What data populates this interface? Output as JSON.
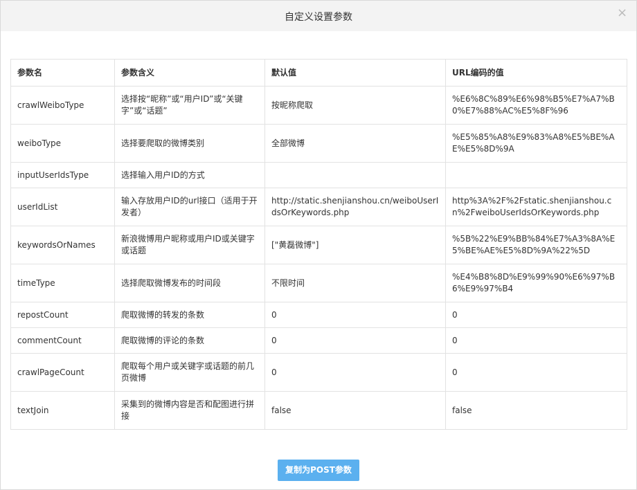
{
  "dialog": {
    "title": "自定义设置参数",
    "close_icon": "×"
  },
  "table": {
    "headers": [
      "参数名",
      "参数含义",
      "默认值",
      "URL编码的值"
    ],
    "rows": [
      {
        "name": "crawlWeiboType",
        "meaning": "选择按“昵称”或“用户ID”或“关键字”或“话题”",
        "default": "按昵称爬取",
        "encoded": "%E6%8C%89%E6%98%B5%E7%A7%B0%E7%88%AC%E5%8F%96"
      },
      {
        "name": "weiboType",
        "meaning": "选择要爬取的微博类别",
        "default": "全部微博",
        "encoded": "%E5%85%A8%E9%83%A8%E5%BE%AE%E5%8D%9A"
      },
      {
        "name": "inputUserIdsType",
        "meaning": "选择输入用户ID的方式",
        "default": "",
        "encoded": ""
      },
      {
        "name": "userIdList",
        "meaning": "输入存放用户ID的url接口（适用于开发者）",
        "default": "http://static.shenjianshou.cn/weiboUserIdsOrKeywords.php",
        "encoded": "http%3A%2F%2Fstatic.shenjianshou.cn%2FweiboUserIdsOrKeywords.php"
      },
      {
        "name": "keywordsOrNames",
        "meaning": "新浪微博用户昵称或用户ID或关键字或话题",
        "default": "[\"黄磊微博\"]",
        "encoded": "%5B%22%E9%BB%84%E7%A3%8A%E5%BE%AE%E5%8D%9A%22%5D"
      },
      {
        "name": "timeType",
        "meaning": "选择爬取微博发布的时间段",
        "default": "不限时间",
        "encoded": "%E4%B8%8D%E9%99%90%E6%97%B6%E9%97%B4"
      },
      {
        "name": "repostCount",
        "meaning": "爬取微博的转发的条数",
        "default": "0",
        "encoded": "0"
      },
      {
        "name": "commentCount",
        "meaning": "爬取微博的评论的条数",
        "default": "0",
        "encoded": "0"
      },
      {
        "name": "crawlPageCount",
        "meaning": "爬取每个用户或关键字或话题的前几页微博",
        "default": "0",
        "encoded": "0"
      },
      {
        "name": "textJoin",
        "meaning": "采集到的微博内容是否和配图进行拼接",
        "default": "false",
        "encoded": "false"
      }
    ]
  },
  "footer": {
    "copy_button_label": "复制为POST参数"
  },
  "colors": {
    "button_bg": "#5bb0ef",
    "header_bg": "#f3f3f3",
    "border": "#e2e2e2"
  }
}
